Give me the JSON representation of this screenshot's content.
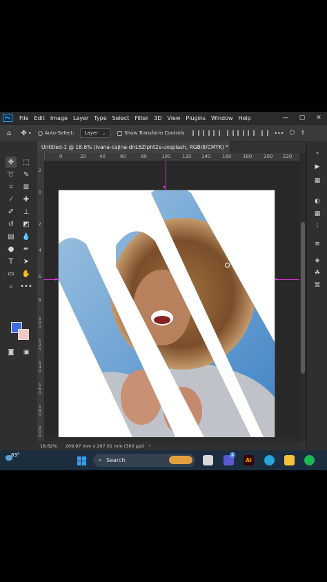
{
  "app": {
    "logo": "Ps",
    "menu": [
      "File",
      "Edit",
      "Image",
      "Layer",
      "Type",
      "Select",
      "Filter",
      "3D",
      "View",
      "Plugins",
      "Window",
      "Help"
    ],
    "window_controls": {
      "minimize": "—",
      "restore": "▢",
      "close": "✕"
    }
  },
  "options_bar": {
    "auto_select_label": "Auto-Select:",
    "auto_select_target": "Layer",
    "show_transform_label": "Show Transform Controls"
  },
  "document": {
    "tab_title": "Untitled-1 @ 18.6% (ivana-cajina-dnL6ZIpht2s-unsplash, RGB/8/CMYK) *",
    "tab_close": "×",
    "ruler_top_labels": [
      "0",
      "20",
      "40",
      "60",
      "80",
      "100",
      "120",
      "140",
      "160",
      "180",
      "200",
      "220"
    ],
    "ruler_left_labels": [
      "2",
      "0",
      "2",
      "4",
      "6",
      "8",
      "1\n0\n0",
      "1\n2\n0",
      "1\n4\n0",
      "1\n6\n0",
      "1\n8\n0",
      "2\n0\n0"
    ]
  },
  "status": {
    "zoom": "18.62%",
    "doc_info": "209.97 mm x 297.01 mm (300 ppi)"
  },
  "taskbar": {
    "weather_temp": "83°",
    "search_placeholder": "Search",
    "icons": [
      "start-icon",
      "task-view-icon",
      "file-manager-icon",
      "teams-icon",
      "illustrator-icon",
      "edge-icon",
      "folder-icon",
      "spotify-icon"
    ],
    "teams_badge": "1",
    "illustrator_label": "Ai"
  },
  "colors": {
    "foreground": "#3f6cdc",
    "background": "#f1c8c4",
    "guide": "#d633d6",
    "app_bg": "#323232"
  }
}
